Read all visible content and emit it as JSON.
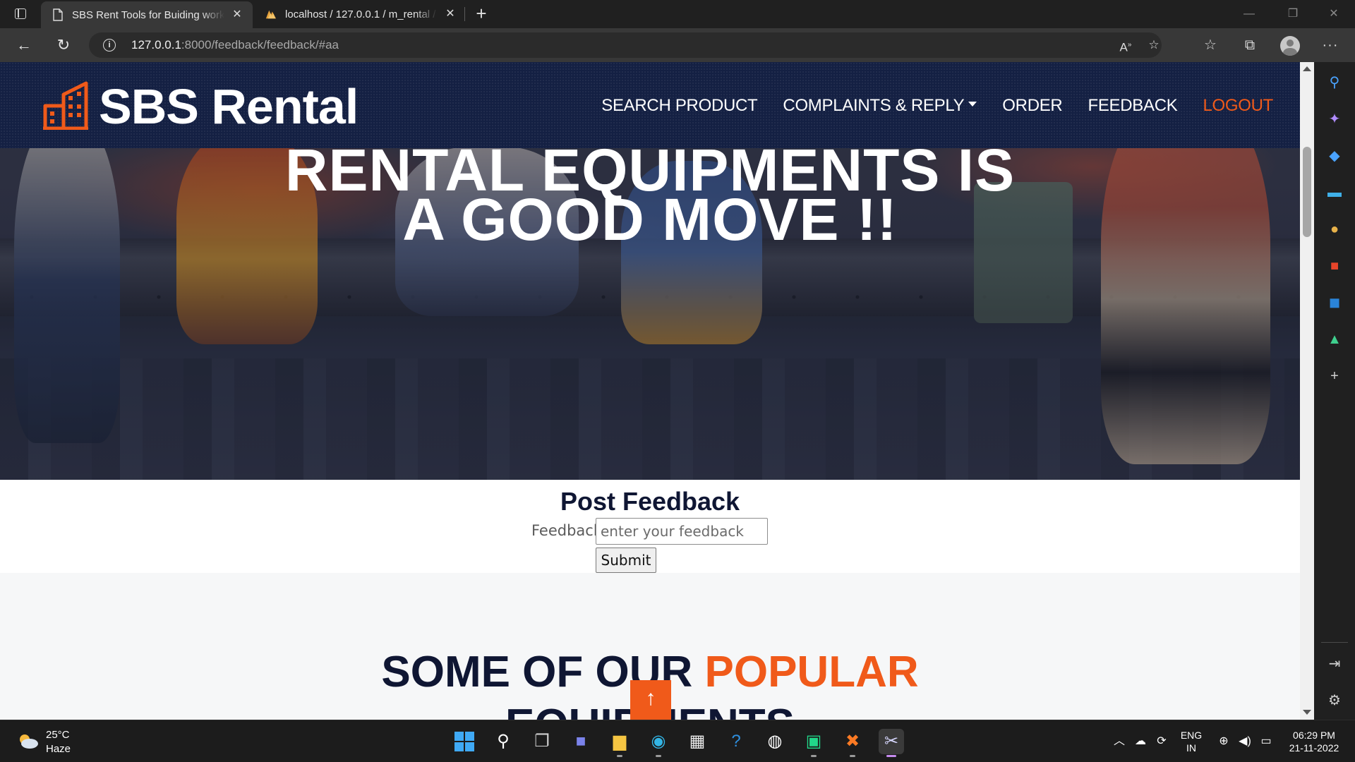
{
  "browser": {
    "tabs": [
      {
        "title": "SBS Rent Tools for Buiding works",
        "active": true
      },
      {
        "title": "localhost / 127.0.0.1 / m_rental / ",
        "active": false
      }
    ],
    "new_tab_label": "+",
    "address": {
      "host": "127.0.0.1",
      "path": ":8000/feedback/feedback/#aa"
    }
  },
  "site": {
    "brand": "SBS Rental",
    "menu": {
      "search_product": "SEARCH PRODUCT",
      "complaints": "COMPLAINTS & REPLY",
      "order": "ORDER",
      "feedback": "FEEDBACK",
      "logout": "LOGOUT"
    },
    "hero": {
      "line1": "RENTAL EQUIPMENTS IS",
      "line2": "A GOOD MOVE !!"
    },
    "feedback_form": {
      "title": "Post Feedback",
      "label": "Feedback",
      "placeholder": "enter your feedback",
      "value": "",
      "submit": "Submit"
    },
    "popular": {
      "part1": "SOME OF OUR ",
      "accent": "POPULAR",
      "line2": "EQUIPMENTS"
    },
    "to_top_icon": "↑"
  },
  "colors": {
    "accent": "#f05a1a",
    "header_bg": "#142043",
    "heading": "#0f1633"
  },
  "taskbar": {
    "weather": {
      "temp": "25°C",
      "desc": "Haze"
    },
    "language": {
      "lang": "ENG",
      "region": "IN"
    },
    "clock": {
      "time": "06:29 PM",
      "date": "21-11-2022"
    }
  }
}
